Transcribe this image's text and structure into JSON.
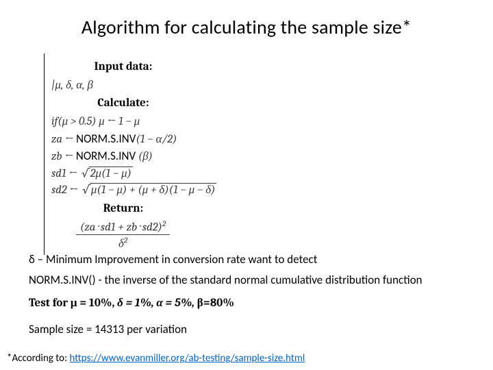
{
  "title": "Algorithm for calculating the sample size*",
  "algorithm": {
    "input_head": "Input data:",
    "input_line": "|μ, δ, α, β",
    "calc_head": "Calculate:",
    "line_if": "if(μ > 0.5) μ ← 1 − μ",
    "line_za_pre": "za ← ",
    "func_norm": "NORM.S.INV",
    "line_za_post": "(1 − α/2)",
    "line_zb_pre": "zb ← ",
    "line_zb_post": " (β)",
    "line_sd1_pre": "sd1 ← ",
    "line_sd1_rad": "2μ(1 − μ)",
    "line_sd2_pre": "sd2 ← ",
    "line_sd2_rad": "μ(1 − μ) + (μ + δ)(1 − μ − δ)",
    "return_head": "Return:",
    "ret_num": "(za · sd1 + zb · sd2)",
    "ret_num_sup": "2",
    "ret_den": "δ",
    "ret_den_sup": "2"
  },
  "notes": {
    "delta": "δ – Minimum Improvement in conversion rate want to detect",
    "norm": "NORM.S.INV() - the inverse of the standard normal cumulative distribution function",
    "test_bold": "Test for μ = 10%, ",
    "test_ital": "δ = 1%, α = 5%, ",
    "test_tail": "β=80%",
    "sample": "Sample size = 14313 per variation"
  },
  "footnote": {
    "prefix": "*According to:  ",
    "link": "https://www.evanmiller.org/ab-testing/sample-size.html"
  }
}
